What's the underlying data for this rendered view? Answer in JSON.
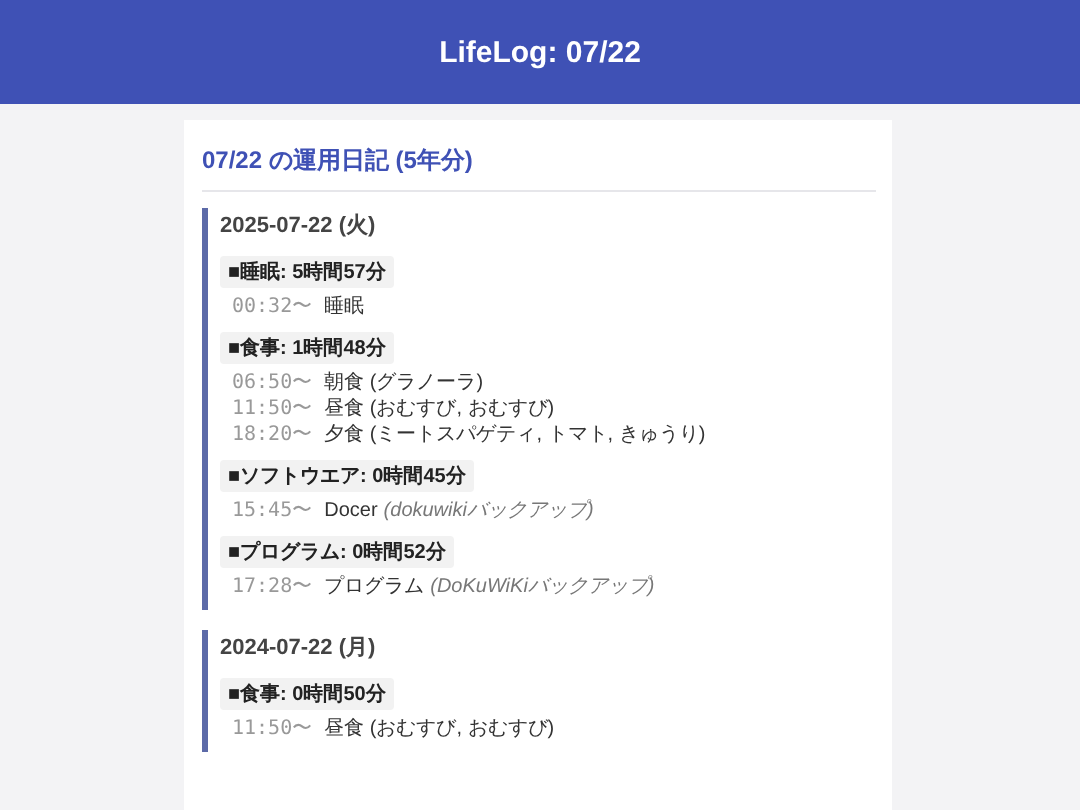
{
  "header": {
    "title": "LifeLog: 07/22"
  },
  "page_title": "07/22 の運用日記 (5年分)",
  "days": [
    {
      "date": "2025-07-22 (火)",
      "categories": [
        {
          "label": "■睡眠: 5時間57分",
          "entries": [
            {
              "time": "00:32〜",
              "text": "睡眠"
            }
          ]
        },
        {
          "label": "■食事: 1時間48分",
          "entries": [
            {
              "time": "06:50〜",
              "text": "朝食 (グラノーラ)"
            },
            {
              "time": "11:50〜",
              "text": "昼食 (おむすび, おむすび)"
            },
            {
              "time": "18:20〜",
              "text": "夕食 (ミートスパゲティ, トマト, きゅうり)"
            }
          ]
        },
        {
          "label": "■ソフトウエア: 0時間45分",
          "entries": [
            {
              "time": "15:45〜",
              "text": "Docer",
              "note": "(dokuwikiバックアップ)"
            }
          ]
        },
        {
          "label": "■プログラム: 0時間52分",
          "entries": [
            {
              "time": "17:28〜",
              "text": "プログラム",
              "note": "(DoKuWiKiバックアップ)"
            }
          ]
        }
      ]
    },
    {
      "date": "2024-07-22 (月)",
      "categories": [
        {
          "label": "■食事: 0時間50分",
          "entries": [
            {
              "time": "11:50〜",
              "text": "昼食 (おむすび, おむすび)"
            }
          ]
        }
      ]
    }
  ]
}
